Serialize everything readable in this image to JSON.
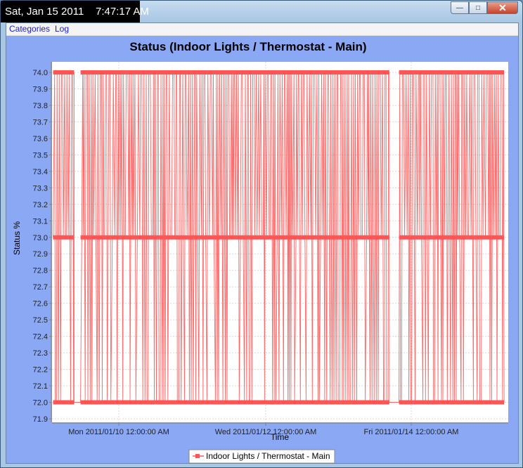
{
  "clock": {
    "date": "Sat, Jan 15 2011",
    "time": "7:47:17 AM"
  },
  "window": {
    "controls": [
      "minimize",
      "maximize",
      "close"
    ]
  },
  "menu": {
    "items": [
      "Categories",
      "Log"
    ]
  },
  "colors": {
    "series": "#ff5555",
    "chart_background": "#8aa8f4",
    "plot_background": "#ffffff",
    "menu_link": "#1a1ad8"
  },
  "chart_data": {
    "type": "line",
    "title": "Status (Indoor Lights / Thermostat - Main)",
    "xlabel": "Time",
    "ylabel": "Status %",
    "x_tick_labels": [
      "Mon 2011/01/10 12:00:00 AM",
      "Wed 2011/01/12 12:00:00 AM",
      "Fri 2011/01/14 12:00:00 AM"
    ],
    "xlim": [
      "2011-01-09T10:40",
      "2011-01-15T07:47"
    ],
    "ylim": [
      71.9,
      74.05
    ],
    "y_ticks": [
      71.9,
      72.0,
      72.1,
      72.2,
      72.3,
      72.4,
      72.5,
      72.6,
      72.7,
      72.8,
      72.9,
      73.0,
      73.1,
      73.2,
      73.3,
      73.4,
      73.5,
      73.6,
      73.7,
      73.8,
      73.9,
      74.0
    ],
    "grid": true,
    "legend_position": "bottom-center",
    "series": [
      {
        "name": "Indoor Lights / Thermostat - Main",
        "values_observed": [
          72.0,
          73.0,
          74.0
        ],
        "active_periods": [
          [
            "2011-01-09T11:00",
            "2011-01-09T17:30"
          ],
          [
            "2011-01-09T19:30",
            "2011-01-13T19:00"
          ],
          [
            "2011-01-13T22:00",
            "2011-01-15T06:30"
          ]
        ],
        "data_gaps": [
          [
            "2011-01-09T17:30",
            "2011-01-09T19:30"
          ],
          [
            "2011-01-13T19:00",
            "2011-01-13T22:00"
          ]
        ]
      }
    ]
  }
}
